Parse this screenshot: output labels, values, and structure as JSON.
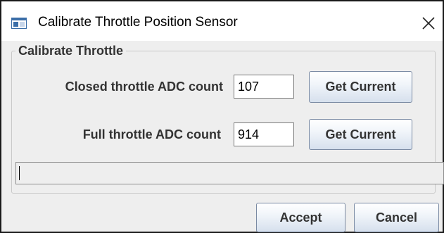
{
  "window": {
    "title": "Calibrate Throttle Position Sensor"
  },
  "group": {
    "title": "Calibrate Throttle"
  },
  "closed_row": {
    "label": "Closed throttle ADC count",
    "value": "107",
    "button_label": "Get Current"
  },
  "full_row": {
    "label": "Full throttle ADC count",
    "value": "914",
    "button_label": "Get Current"
  },
  "progress": {
    "fraction": 0
  },
  "footer": {
    "accept_label": "Accept",
    "cancel_label": "Cancel"
  },
  "icons": {
    "app": "window-app-icon",
    "close": "close-icon"
  },
  "colors": {
    "button_top": "#ffffff",
    "button_bottom": "#d6e0ed",
    "label_text": "#333333"
  }
}
